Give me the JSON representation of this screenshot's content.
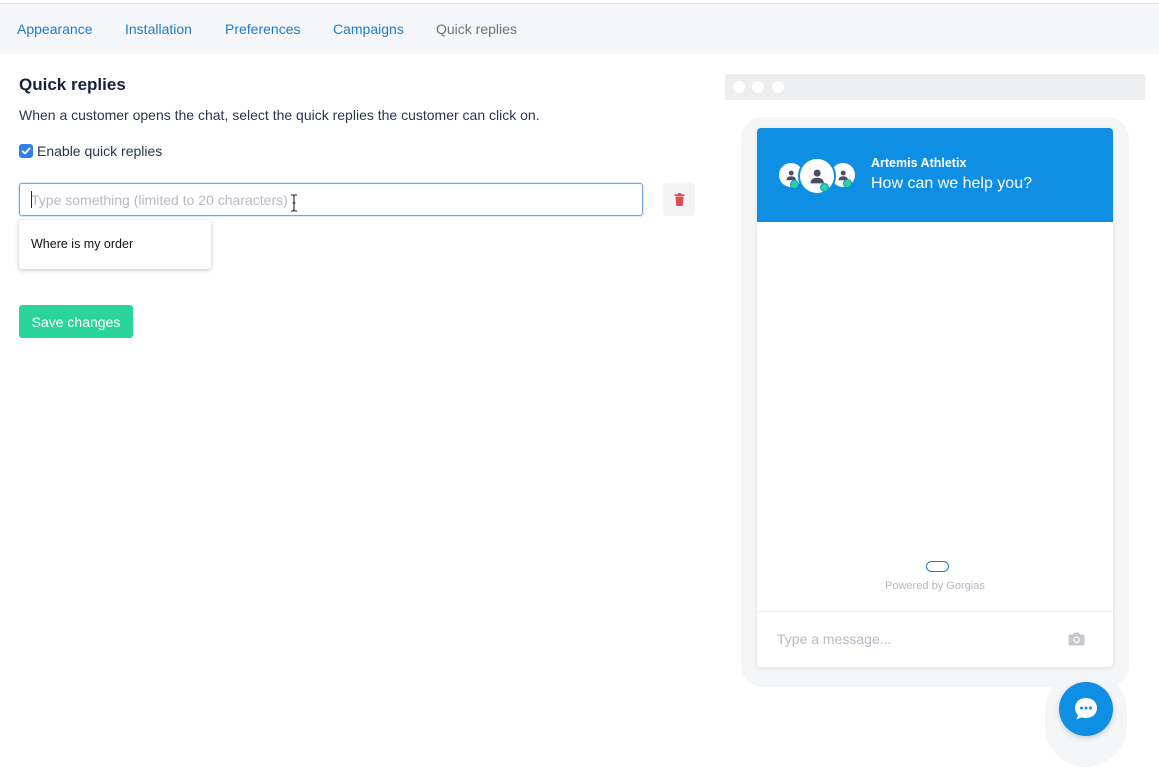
{
  "tabs": [
    {
      "label": "Appearance",
      "active": false
    },
    {
      "label": "Installation",
      "active": false
    },
    {
      "label": "Preferences",
      "active": false
    },
    {
      "label": "Campaigns",
      "active": false
    },
    {
      "label": "Quick replies",
      "active": true
    }
  ],
  "section": {
    "title": "Quick replies",
    "description": "When a customer opens the chat, select the quick replies the customer can click on."
  },
  "enable": {
    "label": "Enable quick replies",
    "checked": true
  },
  "reply_input": {
    "value": "",
    "placeholder": "Type something (limited to 20 characters)"
  },
  "suggestion": {
    "label": "Where is my order"
  },
  "save_label": "Save changes",
  "preview": {
    "brand": "Artemis Athletix",
    "greeting": "How can we help you?",
    "powered_by": "Powered by Gorgias",
    "message_placeholder": "Type a message..."
  },
  "colors": {
    "link": "#1f7bc9",
    "accent": "#0e8fe4",
    "save": "#2bd49b",
    "delete": "#e5484d",
    "online": "#2bd49b"
  },
  "icons": {
    "checkbox": "check-icon",
    "delete": "trash-icon",
    "agent": "user-icon",
    "camera": "camera-icon",
    "launcher": "chat-bubble-icon"
  }
}
